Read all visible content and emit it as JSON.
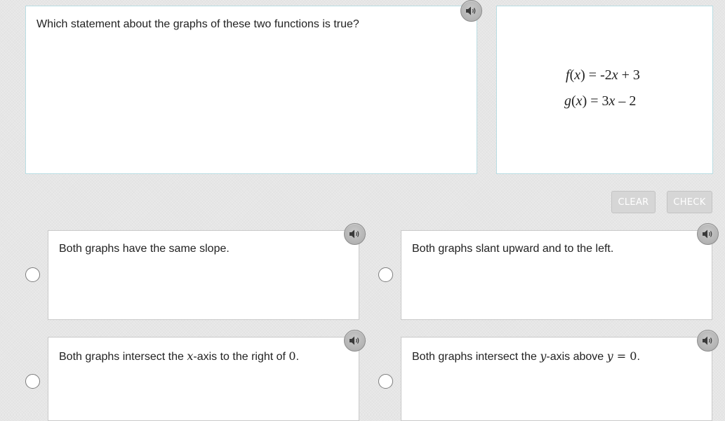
{
  "question": {
    "prompt": "Which statement about the graphs of these two functions is true?"
  },
  "functions": {
    "f": {
      "name": "f",
      "arg": "x",
      "rhs_a": "= -2",
      "rhs_var": "x",
      "rhs_b": "+ 3"
    },
    "g": {
      "name": "g",
      "arg": "x",
      "rhs_a": "= 3",
      "rhs_var": "x",
      "rhs_b": "– 2"
    }
  },
  "buttons": {
    "clear_label": "CLEAR",
    "check_label": "CHECK"
  },
  "options": [
    {
      "text": "Both graphs have the same slope."
    },
    {
      "text": "Both graphs slant upward and to the left."
    },
    {
      "text_pre": "Both graphs intersect the ",
      "var": "x",
      "text_mid": "-axis to the right of ",
      "num": "0",
      "text_post": "."
    },
    {
      "text_pre": "Both graphs intersect the ",
      "var": "y",
      "text_mid": "-axis above ",
      "var2": "y",
      "eq": " = ",
      "num": "0",
      "text_post": "."
    }
  ],
  "icons": {
    "audio": "speaker-icon"
  },
  "colors": {
    "panel_border": "#b9dde3",
    "button_bg": "#d6d6d6",
    "speaker_bg": "#a9a9a9"
  }
}
